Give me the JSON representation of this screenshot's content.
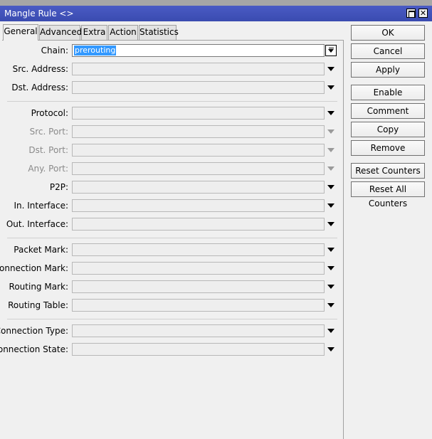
{
  "window": {
    "title": "Mangle Rule <>",
    "restore_icon": "restore-icon",
    "close_icon": "close-icon"
  },
  "tabs": [
    {
      "label": "General",
      "active": true
    },
    {
      "label": "Advanced",
      "active": false
    },
    {
      "label": "Extra",
      "active": false
    },
    {
      "label": "Action",
      "active": false
    },
    {
      "label": "Statistics",
      "active": false
    }
  ],
  "fields": {
    "chain": {
      "label": "Chain:",
      "value": "prerouting"
    },
    "src_address": {
      "label": "Src. Address:",
      "value": ""
    },
    "dst_address": {
      "label": "Dst. Address:",
      "value": ""
    },
    "protocol": {
      "label": "Protocol:",
      "value": ""
    },
    "src_port": {
      "label": "Src. Port:",
      "value": "",
      "disabled": true
    },
    "dst_port": {
      "label": "Dst. Port:",
      "value": "",
      "disabled": true
    },
    "any_port": {
      "label": "Any. Port:",
      "value": "",
      "disabled": true
    },
    "p2p": {
      "label": "P2P:",
      "value": ""
    },
    "in_interface": {
      "label": "In. Interface:",
      "value": ""
    },
    "out_interface": {
      "label": "Out. Interface:",
      "value": ""
    },
    "packet_mark": {
      "label": "Packet Mark:",
      "value": ""
    },
    "connection_mark": {
      "label": "Connection Mark:",
      "value": ""
    },
    "routing_mark": {
      "label": "Routing Mark:",
      "value": ""
    },
    "routing_table": {
      "label": "Routing Table:",
      "value": ""
    },
    "connection_type": {
      "label": "Connection Type:",
      "value": ""
    },
    "connection_state": {
      "label": "Connection State:",
      "value": ""
    }
  },
  "buttons": {
    "ok": "OK",
    "cancel": "Cancel",
    "apply": "Apply",
    "enable": "Enable",
    "comment": "Comment",
    "copy": "Copy",
    "remove": "Remove",
    "reset_counters": "Reset Counters",
    "reset_all_counters": "Reset All Counters"
  },
  "colors": {
    "titlebar": "#3f51b5",
    "selection": "#3399ff"
  }
}
